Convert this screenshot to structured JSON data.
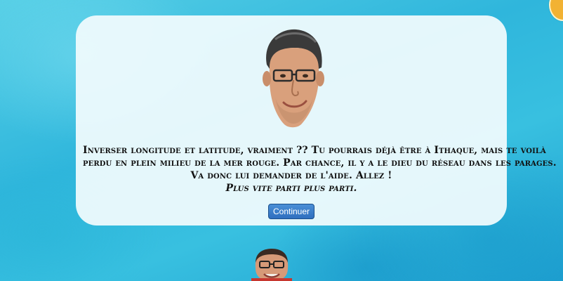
{
  "dialog": {
    "message_lines": [
      "Inverser longitude et latitude, vraiment ?? Tu pourrais déjà être à Ithaque, mais te voilà",
      "perdu en plein milieu de la mer rouge. Par chance, il y a le dieu du réseau dans les parages.",
      "Va donc lui demander de l'aide. Allez !"
    ],
    "tagline": "Plus vite parti plus parti.",
    "continue_label": "Continuer",
    "button_color": "#2f6fbf"
  },
  "theme": {
    "background": "#38c0e0",
    "panel": "#f0fbfd"
  },
  "icons": {
    "top_avatar": "character-portrait",
    "bottom_avatar": "network-god-portrait",
    "corner": "map-marker-icon"
  }
}
